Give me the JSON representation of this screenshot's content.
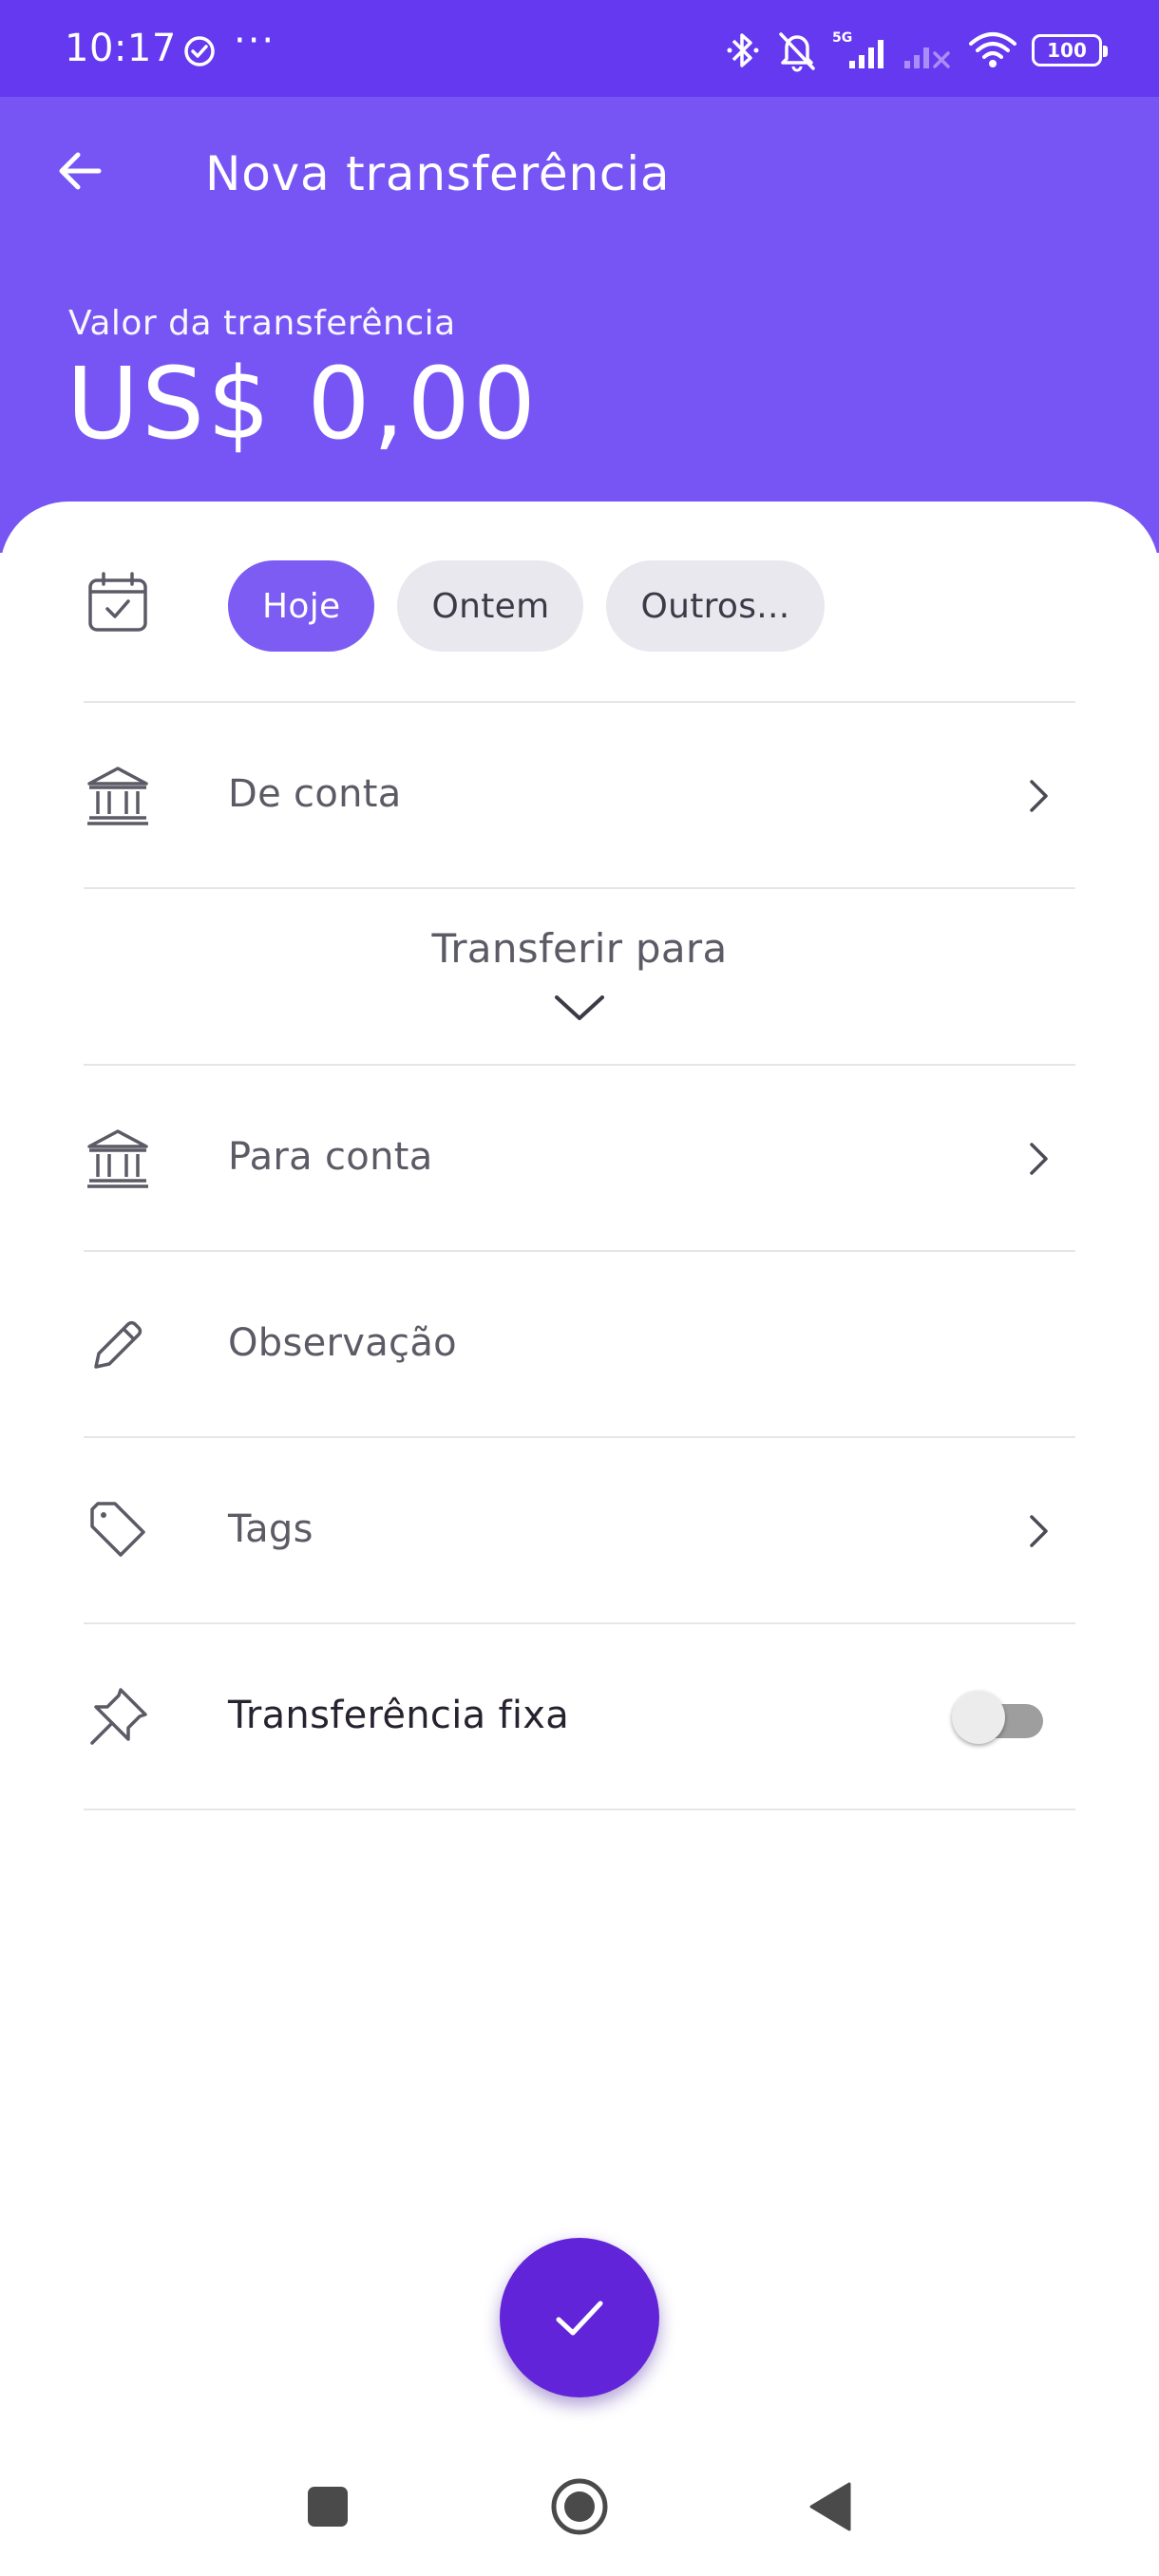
{
  "status_bar": {
    "time": "10:17",
    "more": "···",
    "battery": "100",
    "network": "5G"
  },
  "header": {
    "title": "Nova transferência",
    "amount_label": "Valor da transferência",
    "amount_value": "US$ 0,00",
    "background_color": "#7655f4"
  },
  "date_chips": [
    {
      "label": "Hoje",
      "selected": true
    },
    {
      "label": "Ontem",
      "selected": false
    },
    {
      "label": "Outros...",
      "selected": false
    }
  ],
  "rows": {
    "from_account": "De conta",
    "transfer_to": "Transferir para",
    "to_account": "Para conta",
    "note": "Observação",
    "tags": "Tags",
    "fixed_transfer": "Transferência fixa",
    "fixed_transfer_enabled": false
  },
  "icons": {
    "back": "arrow-left-icon",
    "calendar": "calendar-check-icon",
    "bank": "bank-icon",
    "pencil": "pencil-icon",
    "tag": "tag-icon",
    "pin": "pin-icon",
    "confirm": "check-icon"
  },
  "colors": {
    "status_bar": "#6539f0",
    "accent": "#7c5cf2",
    "fab": "#6224d8"
  }
}
